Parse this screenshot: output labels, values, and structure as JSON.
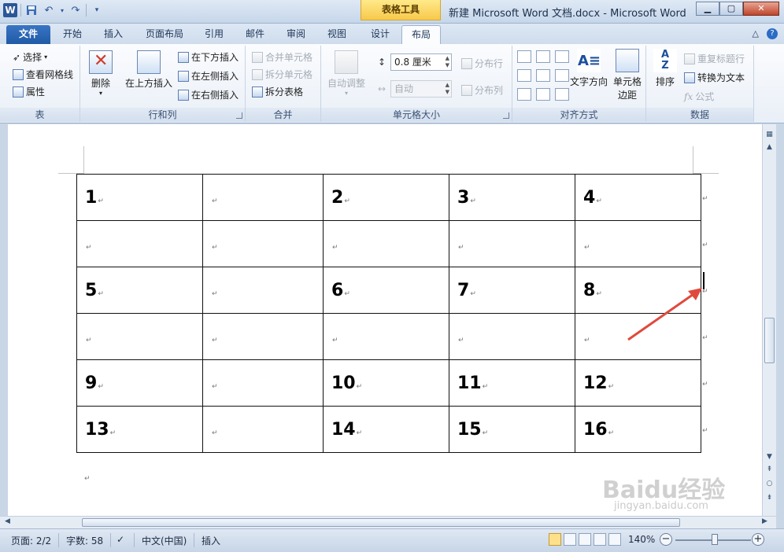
{
  "app": {
    "logo_letter": "W",
    "window_title": "新建 Microsoft Word 文档.docx  -  Microsoft Word",
    "context_tab_group": "表格工具"
  },
  "tabs": [
    "文件",
    "开始",
    "插入",
    "页面布局",
    "引用",
    "邮件",
    "审阅",
    "视图",
    "设计",
    "布局"
  ],
  "active_tab": "布局",
  "ribbon": {
    "table_group": {
      "label": "表",
      "select": "选择",
      "gridlines": "查看网格线",
      "properties": "属性"
    },
    "rows_cols_group": {
      "label": "行和列",
      "delete": "删除",
      "insert_above": "在上方插入",
      "insert_below": "在下方插入",
      "insert_left": "在左侧插入",
      "insert_right": "在右侧插入"
    },
    "merge_group": {
      "label": "合并",
      "merge_cells": "合并单元格",
      "split_cells": "拆分单元格",
      "split_table": "拆分表格"
    },
    "cell_size_group": {
      "label": "单元格大小",
      "autofit": "自动调整",
      "height_value": "0.8 厘米",
      "width_value": "自动",
      "distribute_rows": "分布行",
      "distribute_cols": "分布列"
    },
    "alignment_group": {
      "label": "对齐方式",
      "text_direction": "文字方向",
      "cell_margins_1": "单元格",
      "cell_margins_2": "边距"
    },
    "data_group": {
      "label": "数据",
      "sort": "排序",
      "repeat_header": "重复标题行",
      "convert_to_text": "转换为文本",
      "formula": "公式"
    }
  },
  "table": {
    "rows": [
      [
        "1",
        "",
        "2",
        "3",
        "4"
      ],
      [
        "",
        "",
        "",
        "",
        ""
      ],
      [
        "5",
        "",
        "6",
        "7",
        "8"
      ],
      [
        "",
        "",
        "",
        "",
        ""
      ],
      [
        "9",
        "",
        "10",
        "11",
        "12"
      ],
      [
        "13",
        "",
        "14",
        "15",
        "16"
      ]
    ],
    "paragraph_mark": "↵"
  },
  "status": {
    "page": "页面: 2/2",
    "words": "字数: 58",
    "language": "中文(中国)",
    "mode": "插入",
    "zoom": "140%"
  },
  "watermark": {
    "brand": "Baidu经验",
    "url": "jingyan.baidu.com"
  },
  "colors": {
    "accent": "#2b5797",
    "arrow": "#e04a3c",
    "context": "#f7c94b"
  }
}
